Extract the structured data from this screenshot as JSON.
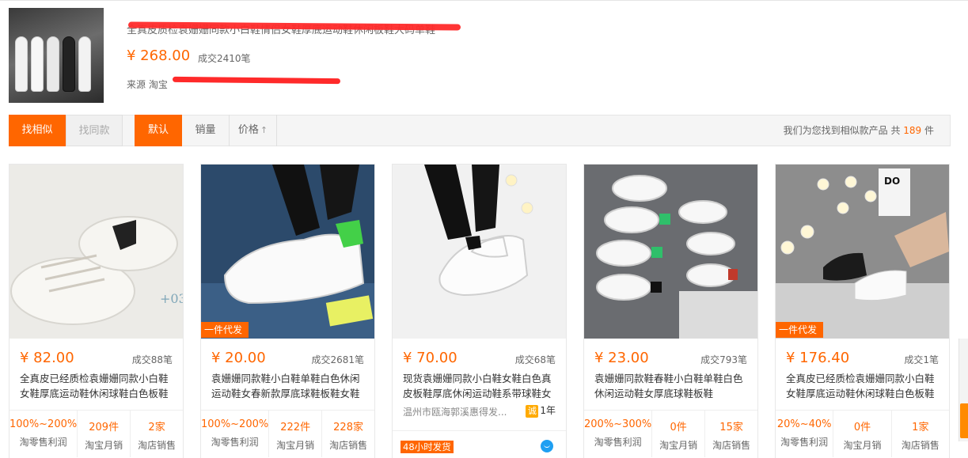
{
  "header": {
    "title": "全真皮质检袁姗姗同款小白鞋情侣女鞋厚底运动鞋休闲板鞋大码单鞋",
    "price": "¥ 268.00",
    "deals": "成交2410笔",
    "source": "来源 淘宝"
  },
  "toolbar": {
    "find_similar": "找相似",
    "find_same": "找同款",
    "sort_default": "默认",
    "sort_sales": "销量",
    "sort_price": "价格",
    "sort_price_arrow": "↑",
    "result_prefix": "我们为您找到相似款产品 共 ",
    "result_count": "189",
    "result_suffix": " 件"
  },
  "products": [
    {
      "badge": "",
      "price": "¥ 82.00",
      "deals": "成交88笔",
      "title": "全真皮已经质检袁姗姗同款小白鞋女鞋厚底运动鞋休闲球鞋白色板鞋",
      "stats": [
        {
          "value": "100%~200%",
          "label": "淘零售利润"
        },
        {
          "value": "209件",
          "label": "淘宝月销"
        },
        {
          "value": "2家",
          "label": "淘店销售"
        }
      ]
    },
    {
      "badge": "一件代发",
      "price": "¥ 20.00",
      "deals": "成交2681笔",
      "title": "袁姗姗同款鞋小白鞋单鞋白色休闲运动鞋女春新款厚底球鞋板鞋女鞋",
      "stats": [
        {
          "value": "100%~200%",
          "label": "淘零售利润"
        },
        {
          "value": "222件",
          "label": "淘宝月销"
        },
        {
          "value": "228家",
          "label": "淘店销售"
        }
      ]
    },
    {
      "badge": "",
      "price": "¥ 70.00",
      "deals": "成交68笔",
      "title": "现货袁姗姗同款小白鞋女鞋白色真皮板鞋厚底休闲运动鞋系带球鞋女",
      "seller": "温州市瓯海郭溪惠得发...",
      "seller_icon": "诚",
      "seller_years": "1年",
      "shipping": "48小时发货"
    },
    {
      "badge": "",
      "price": "¥ 23.00",
      "deals": "成交793笔",
      "title": "袁姗姗同款鞋春鞋小白鞋单鞋白色休闲运动鞋女厚底球鞋板鞋",
      "stats": [
        {
          "value": "200%~300%",
          "label": "淘零售利润"
        },
        {
          "value": "0件",
          "label": "淘宝月销"
        },
        {
          "value": "15家",
          "label": "淘店销售"
        }
      ]
    },
    {
      "badge": "一件代发",
      "price": "¥ 176.40",
      "deals": "成交1笔",
      "title": "全真皮已经质检袁姗姗同款小白鞋女鞋厚底运动鞋休闲球鞋白色板鞋",
      "stats": [
        {
          "value": "20%~40%",
          "label": "淘零售利润"
        },
        {
          "value": "0件",
          "label": "淘宝月销"
        },
        {
          "value": "1家",
          "label": "淘店销售"
        }
      ]
    }
  ],
  "colors": {
    "accent": "#ff6600",
    "redacted": "#ff2a2a",
    "chat": "#1e9ff2"
  }
}
